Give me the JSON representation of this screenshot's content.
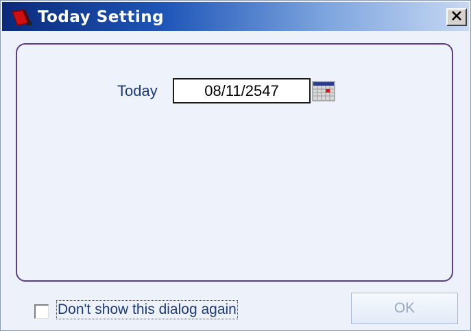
{
  "window": {
    "title": "Today Setting",
    "close_icon": "close-icon"
  },
  "form": {
    "today_label": "Today",
    "date_value": "08/11/2547",
    "calendar_icon": "calendar-icon"
  },
  "footer": {
    "checkbox_label": "Don't show this dialog again",
    "checkbox_checked": false,
    "ok_label": "OK",
    "ok_enabled": false
  },
  "colors": {
    "title_start": "#0a2a7a",
    "title_end": "#c7d8f2",
    "panel_border": "#5b3c8c",
    "label_text": "#1e3a7a"
  }
}
